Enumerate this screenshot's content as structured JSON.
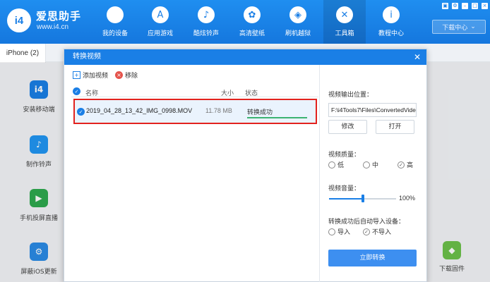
{
  "app": {
    "name": "爱思助手",
    "url": "www.i4.cn",
    "logo_text": "i4"
  },
  "nav": [
    {
      "label": "我的设备",
      "icon": "apple-icon",
      "glyph": ""
    },
    {
      "label": "应用游戏",
      "icon": "app-store-icon",
      "glyph": "A"
    },
    {
      "label": "酷炫铃声",
      "icon": "bell-icon",
      "glyph": "♪"
    },
    {
      "label": "高清壁纸",
      "icon": "flower-icon",
      "glyph": "✿"
    },
    {
      "label": "刷机越狱",
      "icon": "box-icon",
      "glyph": "◈"
    },
    {
      "label": "工具箱",
      "icon": "tools-icon",
      "glyph": "✕"
    },
    {
      "label": "教程中心",
      "icon": "info-icon",
      "glyph": "i"
    }
  ],
  "window": {
    "download_center": "下载中心",
    "download_icon": "chevron-down-icon"
  },
  "device_tab": "iPhone (2)",
  "tools_left": [
    {
      "label": "安装移动端",
      "icon": "i4-app-icon",
      "color": "#1a7fe6",
      "glyph": "i4"
    },
    {
      "label": "制作铃声",
      "icon": "bell-icon",
      "color": "#2196f3",
      "glyph": "♪"
    },
    {
      "label": "手机投屏直播",
      "icon": "screen-cast-icon",
      "color": "#2eaa4f",
      "glyph": "▶"
    },
    {
      "label": "屏蔽iOS更新",
      "icon": "gear-icon",
      "color": "#2b8be6",
      "glyph": "⚙"
    }
  ],
  "tool_right": {
    "label": "下载固件",
    "icon": "cube-icon",
    "color": "#6cc24a",
    "glyph": "◆"
  },
  "dialog": {
    "title": "转换视频",
    "add_video": "添加视频",
    "remove": "移除",
    "columns": {
      "name": "名称",
      "size": "大小",
      "status": "状态"
    },
    "files": [
      {
        "name": "2019_04_28_13_42_IMG_0998.MOV",
        "size": "11.78 MB",
        "status": "转换成功",
        "progress": 1.0
      }
    ],
    "output_label": "视频输出位置：",
    "output_path": "F:\\i4Tools7\\Files\\ConvertedVideo",
    "modify": "修改",
    "open": "打开",
    "quality_label": "视频质量：",
    "quality_options": [
      "低",
      "中",
      "高"
    ],
    "quality_selected": "高",
    "volume_label": "视频音量：",
    "volume_value": "100%",
    "volume_level": 0.5,
    "auto_import_label": "转换成功后自动导入设备：",
    "import_options": [
      "导入",
      "不导入"
    ],
    "import_selected": "不导入",
    "convert_button": "立即转换"
  }
}
